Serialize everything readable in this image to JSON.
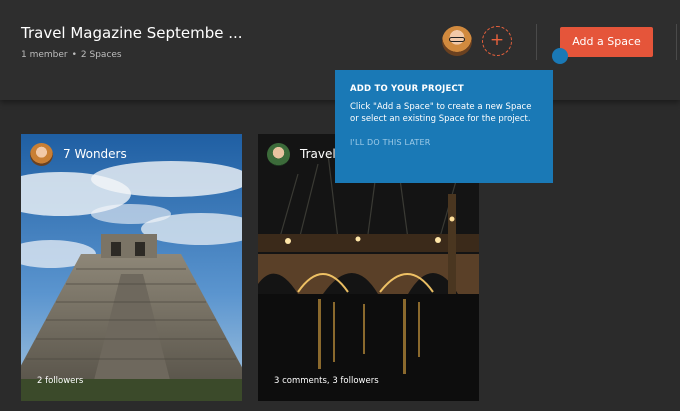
{
  "header": {
    "title": "Travel Magazine Septembe ...",
    "members": "1 member",
    "separator": "•",
    "spaces": "2 Spaces",
    "add_member_symbol": "+",
    "add_space_label": "Add a Space"
  },
  "tooltip": {
    "title": "ADD TO YOUR PROJECT",
    "body": "Click \"Add a Space\" to create a new Space or select an existing Space for the project.",
    "later": "I'LL DO THIS LATER"
  },
  "cards": [
    {
      "title": "7 Wonders",
      "stats": "2 followers"
    },
    {
      "title": "Travel",
      "stats": "3 comments, 3 followers"
    }
  ],
  "colors": {
    "accent": "#e5553a",
    "tooltip": "#1a79b6",
    "background": "#2b2b2b"
  }
}
